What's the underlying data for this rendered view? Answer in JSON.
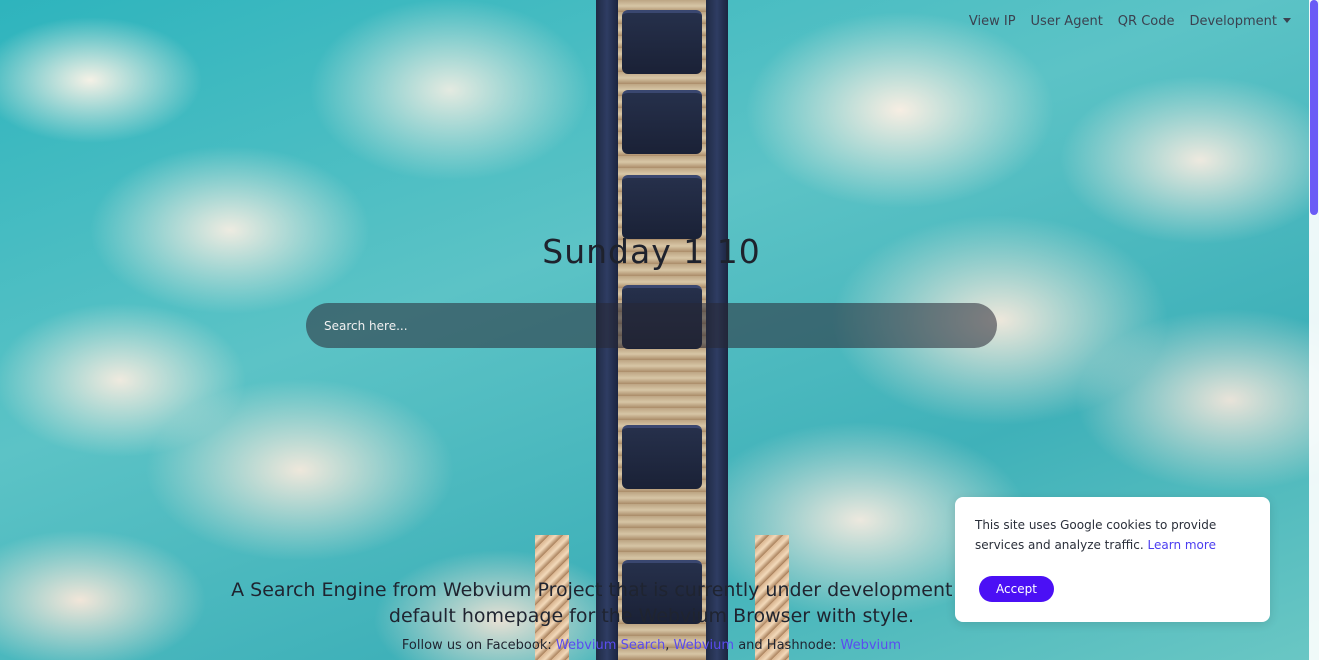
{
  "nav": {
    "items": [
      {
        "label": "View IP"
      },
      {
        "label": "User Agent"
      },
      {
        "label": "QR Code"
      },
      {
        "label": "Development"
      }
    ]
  },
  "clock": {
    "text": "Sunday 1 10"
  },
  "search": {
    "placeholder": "Search here..."
  },
  "tagline": {
    "text": "A Search Engine from Webvium Project that is currently under development project. The default homepage for the Webvium Browser with style."
  },
  "follow": {
    "prefix": "Follow us on Facebook: ",
    "facebook_link": "Webvium Search",
    "middle": ", ",
    "github_link": "Webvium",
    "hashnode_prefix": " and Hashnode: ",
    "hashnode_link": "Webvium"
  },
  "cookie": {
    "text": "This site uses Google cookies to provide services and analyze traffic. ",
    "learn_more": "Learn more",
    "accept_label": "Accept"
  },
  "colors": {
    "accent": "#4b10f5",
    "link": "#5a4cf0",
    "scroll_thumb": "#6a5cf6"
  }
}
